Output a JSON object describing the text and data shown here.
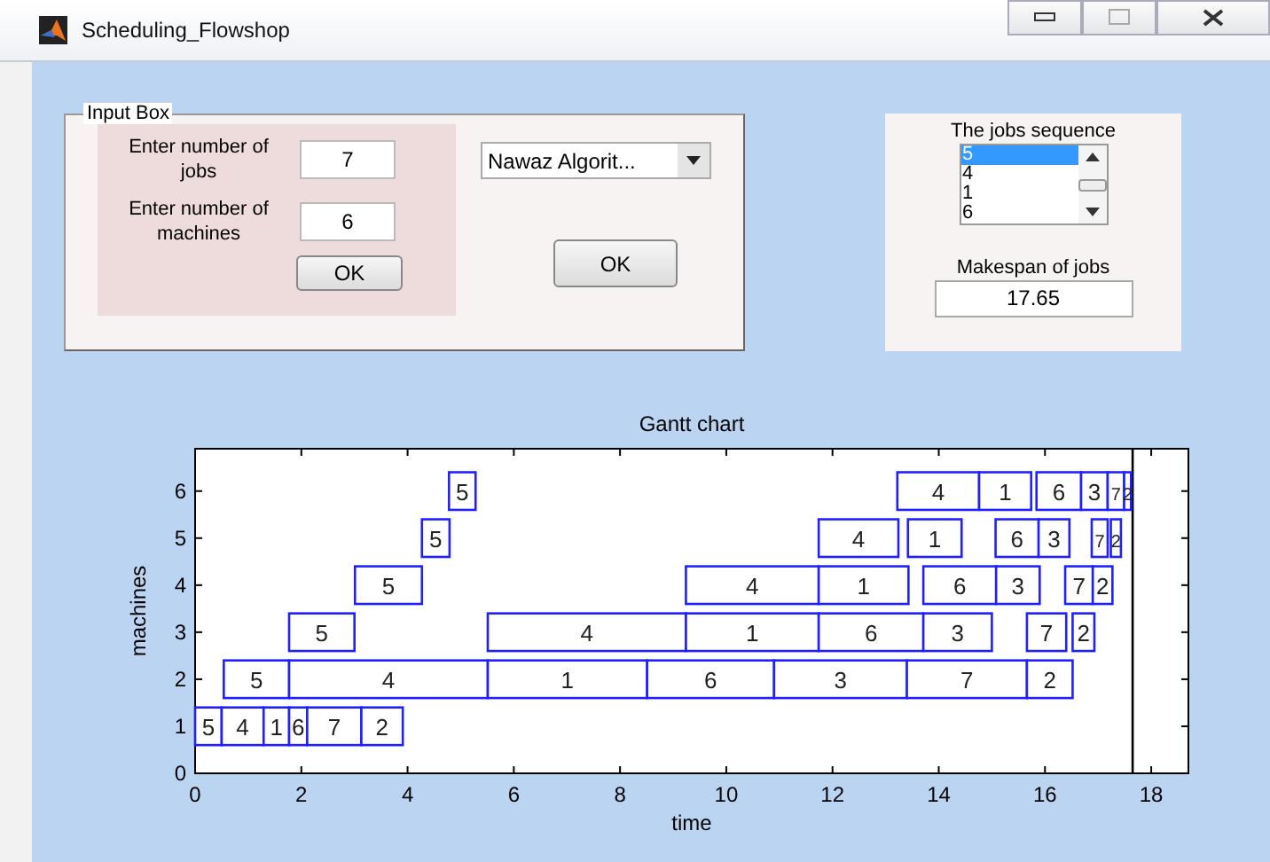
{
  "window": {
    "title": "Scheduling_Flowshop"
  },
  "input_box": {
    "title": "Input Box",
    "jobs_label": "Enter number of jobs",
    "jobs_value": "7",
    "machines_label": "Enter number of machines",
    "machines_value": "6",
    "ok_button": "OK"
  },
  "algorithm": {
    "value": "Nawaz Algorit...",
    "button": "OK"
  },
  "results": {
    "sequence_label": "The jobs sequence",
    "sequence": [
      {
        "label": "5",
        "selected": true
      },
      {
        "label": "4",
        "selected": false
      },
      {
        "label": "1",
        "selected": false
      },
      {
        "label": "6",
        "selected": false
      }
    ],
    "makespan_label": "Makespan of jobs",
    "makespan_value": "17.65"
  },
  "gantt_chart": {
    "title": "Gantt chart",
    "xlabel": "time",
    "ylabel": "machines",
    "xticks": [
      "0",
      "2",
      "4",
      "6",
      "8",
      "10",
      "12",
      "14",
      "16",
      "18"
    ],
    "yticks": [
      "6",
      "5",
      "4",
      "3",
      "2",
      "1",
      "0"
    ],
    "machines": [
      {
        "tasks": [
          {
            "job": "5"
          },
          {
            "job": "4"
          },
          {
            "job": "1"
          },
          {
            "job": "6"
          },
          {
            "job": "3"
          },
          {
            "job": "7"
          },
          {
            "job": "2"
          }
        ]
      },
      {
        "tasks": [
          {
            "job": "5"
          },
          {
            "job": "4"
          },
          {
            "job": "1"
          },
          {
            "job": "6"
          },
          {
            "job": "3"
          },
          {
            "job": "7"
          },
          {
            "job": "2"
          }
        ]
      },
      {
        "tasks": [
          {
            "job": "5"
          },
          {
            "job": "4"
          },
          {
            "job": "1"
          },
          {
            "job": "6"
          },
          {
            "job": "3"
          },
          {
            "job": "7"
          },
          {
            "job": "2"
          }
        ]
      },
      {
        "tasks": [
          {
            "job": "5"
          },
          {
            "job": "4"
          },
          {
            "job": "1"
          },
          {
            "job": "6"
          },
          {
            "job": "3"
          },
          {
            "job": "7"
          },
          {
            "job": "2"
          }
        ]
      },
      {
        "tasks": [
          {
            "job": "5"
          },
          {
            "job": "4"
          },
          {
            "job": "1"
          },
          {
            "job": "6"
          },
          {
            "job": "3"
          },
          {
            "job": "7"
          },
          {
            "job": "2"
          }
        ]
      },
      {
        "tasks": [
          {
            "job": "5"
          },
          {
            "job": "4"
          },
          {
            "job": "1"
          },
          {
            "job": "6"
          },
          {
            "job": "7"
          },
          {
            "job": "2"
          }
        ]
      }
    ]
  }
}
